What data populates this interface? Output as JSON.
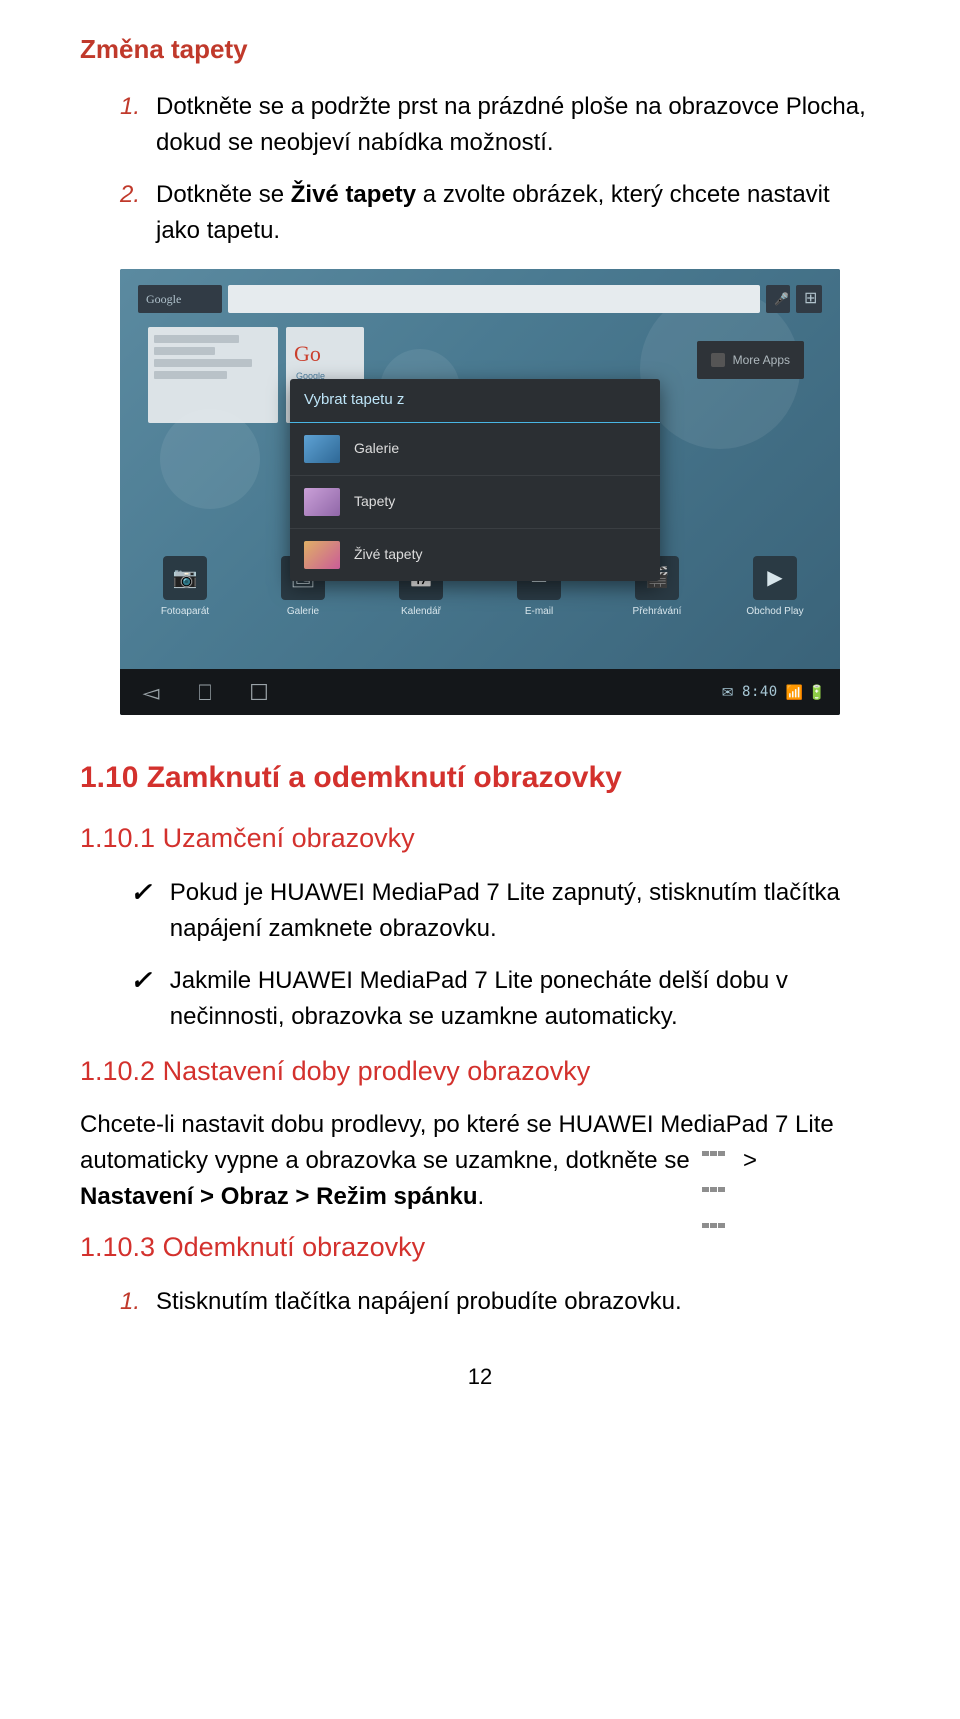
{
  "title": "Změna tapety",
  "steps_a": [
    {
      "num": "1.",
      "text": "Dotkněte se a podržte prst na prázdné ploše na obrazovce Plocha, dokud se neobjeví nabídka možností."
    },
    {
      "num": "2.",
      "html": "Dotkněte se <b>Živé tapety</b> a zvolte obrázek, který chcete nastavit jako tapetu."
    }
  ],
  "figure": {
    "google_logo": "Google",
    "moreapps": "More Apps",
    "small_google": "Go",
    "small_sub": "Google",
    "dialog_title": "Vybrat tapetu z",
    "dialog_items": [
      {
        "label": "Galerie"
      },
      {
        "label": "Tapety"
      },
      {
        "label": "Živé tapety"
      }
    ],
    "desk_icons": [
      {
        "glyph": "📷",
        "label": "Fotoaparát"
      },
      {
        "glyph": "🖼",
        "label": "Galerie"
      },
      {
        "glyph": "📅",
        "label": "Kalendář"
      },
      {
        "glyph": "✉",
        "label": "E-mail"
      },
      {
        "glyph": "🎬",
        "label": "Přehrávání"
      },
      {
        "glyph": "▶",
        "label": "Obchod Play"
      }
    ],
    "clock": "8:40",
    "status_icons": "📶 🔋"
  },
  "h_110": "1.10 Zamknutí a odemknutí obrazovky",
  "h_1101": "1.10.1 Uzamčení obrazovky",
  "checks": [
    "Pokud je HUAWEI MediaPad 7 Lite zapnutý, stisknutím tlačítka napájení zamknete obrazovku.",
    "Jakmile HUAWEI MediaPad 7 Lite ponecháte delší dobu v nečinnosti, obrazovka se uzamkne automaticky."
  ],
  "h_1102": "1.10.2 Nastavení doby prodlevy obrazovky",
  "para_1102_a": "Chcete-li nastavit dobu prodlevy, po které se HUAWEI MediaPad 7 Lite",
  "para_1102_b": "automaticky vypne a obrazovka se uzamkne, dotkněte se ",
  "para_1102_c": " > ",
  "para_1102_d": "Nastavení > Obraz > Režim spánku",
  "para_1102_e": ".",
  "h_1103": "1.10.3 Odemknutí obrazovky",
  "steps_b": [
    {
      "num": "1.",
      "text": "Stisknutím tlačítka napájení probudíte obrazovku."
    }
  ],
  "page_num": "12"
}
